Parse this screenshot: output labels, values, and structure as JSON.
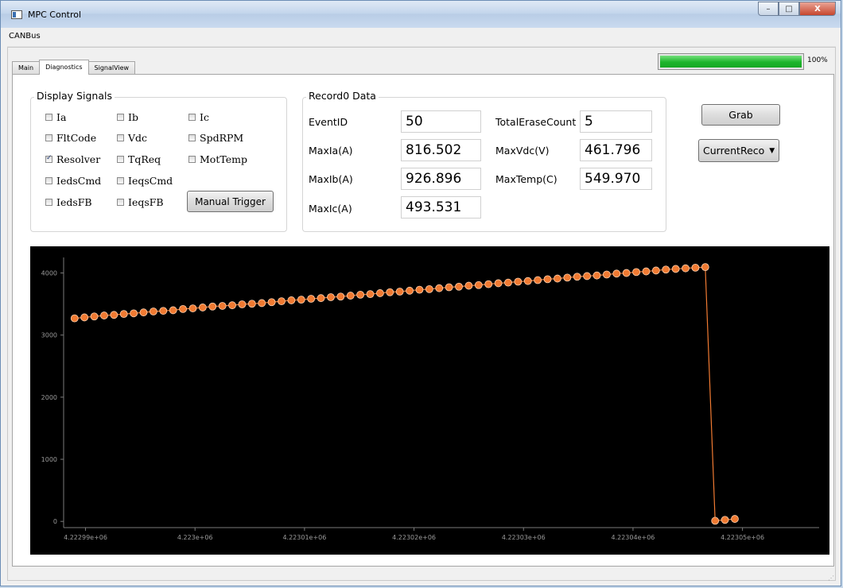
{
  "window": {
    "title": "MPC Control",
    "minimize": "–",
    "maximize": "□",
    "close": "X"
  },
  "menu": {
    "canbus": "CANBus"
  },
  "tabs": [
    {
      "label": "Main"
    },
    {
      "label": "Diagnostics"
    },
    {
      "label": "SignalView"
    }
  ],
  "progress": {
    "value": 100,
    "label": "100%"
  },
  "display_signals": {
    "title": "Display Signals",
    "checkboxes": [
      {
        "label": "Ia",
        "checked": false
      },
      {
        "label": "Ib",
        "checked": false
      },
      {
        "label": "Ic",
        "checked": false
      },
      {
        "label": "FltCode",
        "checked": false
      },
      {
        "label": "Vdc",
        "checked": false
      },
      {
        "label": "SpdRPM",
        "checked": false
      },
      {
        "label": "Resolver",
        "checked": true
      },
      {
        "label": "TqReq",
        "checked": false
      },
      {
        "label": "MotTemp",
        "checked": false
      },
      {
        "label": "IedsCmd",
        "checked": false
      },
      {
        "label": "IeqsCmd",
        "checked": false
      },
      {
        "label": "IedsFB",
        "checked": false
      },
      {
        "label": "IeqsFB",
        "checked": false
      }
    ],
    "manual_trigger": "Manual Trigger"
  },
  "record": {
    "title": "Record0 Data",
    "fields": [
      {
        "label": "EventID",
        "value": "50"
      },
      {
        "label": "TotalEraseCount",
        "value": "5"
      },
      {
        "label": "MaxIa(A)",
        "value": "816.502"
      },
      {
        "label": "MaxVdc(V)",
        "value": "461.796"
      },
      {
        "label": "MaxIb(A)",
        "value": "926.896"
      },
      {
        "label": "MaxTemp(C)",
        "value": "549.970"
      },
      {
        "label": "MaxIc(A)",
        "value": "493.531"
      }
    ]
  },
  "actions": {
    "grab": "Grab",
    "record_select": "CurrentReco"
  },
  "colors": {
    "series": "#f07a32",
    "progress": "#1db52b",
    "plot_bg": "#000000"
  },
  "chart_data": {
    "type": "line",
    "ylim": [
      -100,
      4250
    ],
    "xlim": [
      4222988,
      4223057
    ],
    "yticks": [
      0,
      1000,
      2000,
      3000,
      4000
    ],
    "xticks": [
      {
        "value": 4222990,
        "label": "4.22299e+06"
      },
      {
        "value": 4223000,
        "label": "4.223e+06"
      },
      {
        "value": 4223010,
        "label": "4.22301e+06"
      },
      {
        "value": 4223020,
        "label": "4.22302e+06"
      },
      {
        "value": 4223030,
        "label": "4.22303e+06"
      },
      {
        "value": 4223040,
        "label": "4.22304e+06"
      },
      {
        "value": 4223050,
        "label": "4.22305e+06"
      }
    ],
    "grid": false,
    "series": [
      {
        "x_start": 4222989,
        "x_step": 0.9,
        "values": [
          3270,
          3285,
          3300,
          3315,
          3325,
          3340,
          3350,
          3365,
          3380,
          3390,
          3400,
          3420,
          3430,
          3445,
          3460,
          3470,
          3480,
          3495,
          3505,
          3515,
          3530,
          3545,
          3560,
          3570,
          3585,
          3595,
          3610,
          3620,
          3635,
          3650,
          3660,
          3675,
          3690,
          3700,
          3715,
          3730,
          3740,
          3755,
          3770,
          3780,
          3795,
          3805,
          3820,
          3835,
          3845,
          3860,
          3870,
          3885,
          3900,
          3910,
          3925,
          3940,
          3950,
          3960,
          3975,
          3990,
          4000,
          4015,
          4025,
          4040,
          4055,
          4065,
          4075,
          4085,
          4095,
          10,
          25,
          40
        ]
      }
    ]
  }
}
